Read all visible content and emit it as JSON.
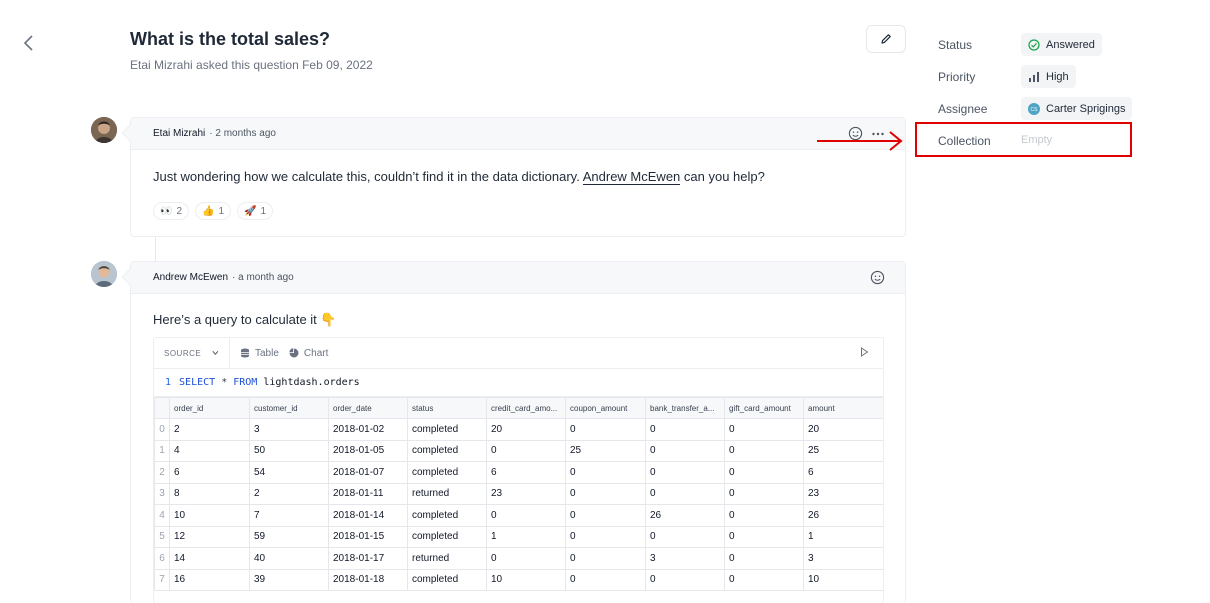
{
  "question": {
    "title": "What is the total sales?",
    "subtitle": "Etai Mizrahi asked this question Feb 09, 2022"
  },
  "comment1": {
    "author": "Etai Mizrahi",
    "time": "· 2 months ago",
    "text_before": "Just wondering how we calculate this, couldn’t find it in the data dictionary. ",
    "mention": "Andrew McEwen",
    "text_after": " can you help?",
    "reactions": [
      {
        "emoji": "👀",
        "count": "2"
      },
      {
        "emoji": "👍",
        "count": "1"
      },
      {
        "emoji": "🚀",
        "count": "1"
      }
    ]
  },
  "comment2": {
    "author": "Andrew McEwen",
    "time": "· a month ago",
    "text": "Here’s a query to calculate it 👇",
    "toolbar": {
      "source_label": "SOURCE",
      "table_label": "Table",
      "chart_label": "Chart"
    },
    "sql": {
      "line_number": "1",
      "keyword1": "SELECT",
      "star": "*",
      "keyword2": "FROM",
      "table": "lightdash.orders"
    },
    "columns": [
      "order_id",
      "customer_id",
      "order_date",
      "status",
      "credit_card_amo...",
      "coupon_amount",
      "bank_transfer_a...",
      "gift_card_amount",
      "amount"
    ],
    "rows": [
      [
        "0",
        "2",
        "3",
        "2018-01-02",
        "completed",
        "20",
        "0",
        "0",
        "0",
        "20"
      ],
      [
        "1",
        "4",
        "50",
        "2018-01-05",
        "completed",
        "0",
        "25",
        "0",
        "0",
        "25"
      ],
      [
        "2",
        "6",
        "54",
        "2018-01-07",
        "completed",
        "6",
        "0",
        "0",
        "0",
        "6"
      ],
      [
        "3",
        "8",
        "2",
        "2018-01-11",
        "returned",
        "23",
        "0",
        "0",
        "0",
        "23"
      ],
      [
        "4",
        "10",
        "7",
        "2018-01-14",
        "completed",
        "0",
        "0",
        "26",
        "0",
        "26"
      ],
      [
        "5",
        "12",
        "59",
        "2018-01-15",
        "completed",
        "1",
        "0",
        "0",
        "0",
        "1"
      ],
      [
        "6",
        "14",
        "40",
        "2018-01-17",
        "returned",
        "0",
        "0",
        "3",
        "0",
        "3"
      ],
      [
        "7",
        "16",
        "39",
        "2018-01-18",
        "completed",
        "10",
        "0",
        "0",
        "0",
        "10"
      ]
    ]
  },
  "sidebar": {
    "status_label": "Status",
    "status_value": "Answered",
    "priority_label": "Priority",
    "priority_value": "High",
    "assignee_label": "Assignee",
    "assignee_value": "Carter Sprigings",
    "collection_label": "Collection",
    "collection_value": "Empty"
  },
  "colors": {
    "highlight": "#e00000",
    "answered_green": "#16a34a",
    "assignee_avatar": "#4fa3c4"
  }
}
